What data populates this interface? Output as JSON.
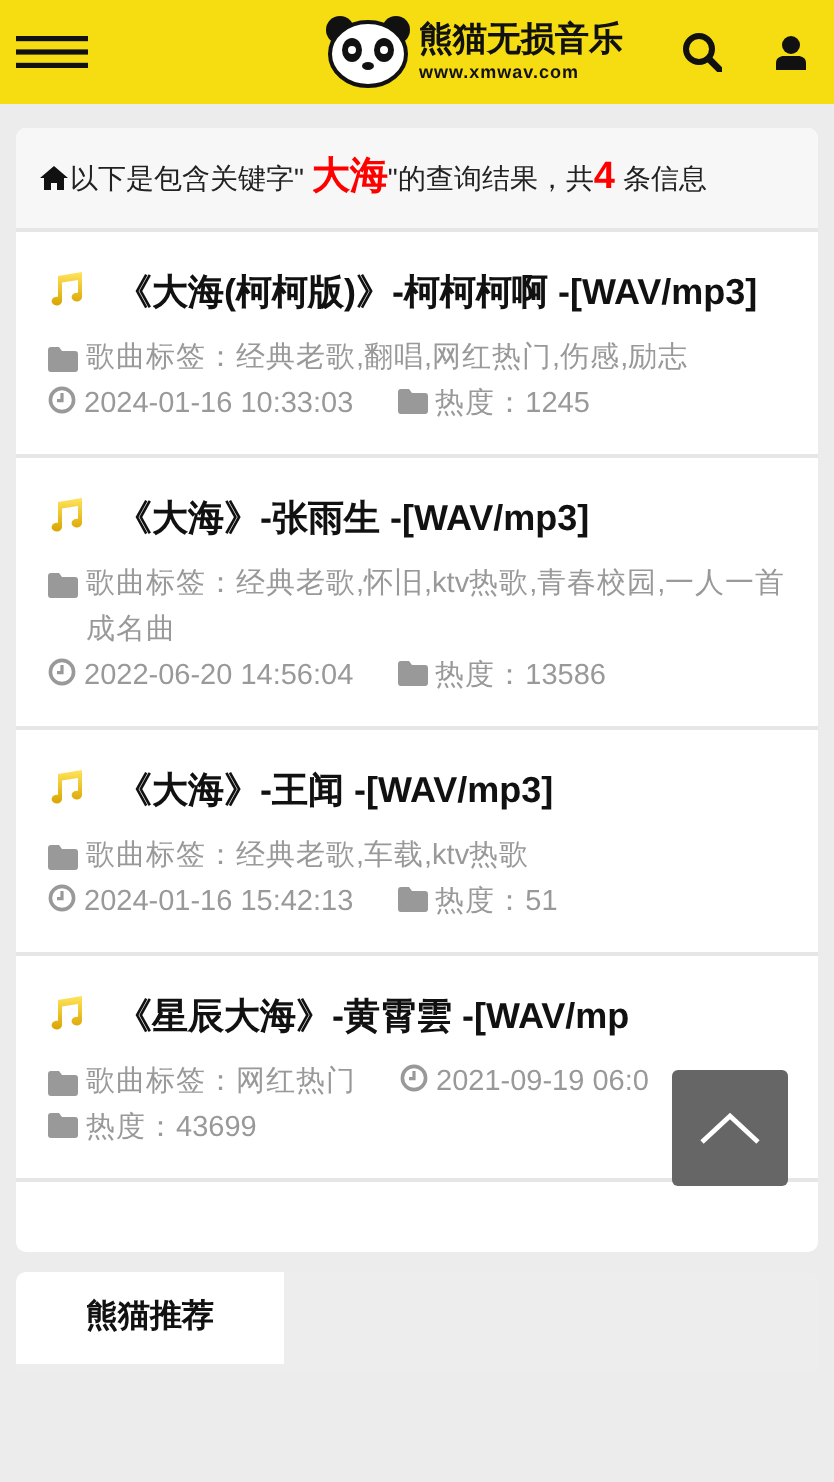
{
  "header": {
    "logo": {
      "title": "熊猫无损音乐",
      "url": "www.xmwav.com"
    }
  },
  "summary": {
    "prefix": "以下是包含关键字\"",
    "keyword": "大海",
    "middle": "\"的查询结果，共",
    "count": "4",
    "suffix": "条信息"
  },
  "results": [
    {
      "title": "《大海(柯柯版)》-柯柯柯啊 -[WAV/mp3]",
      "tags": "歌曲标签：经典老歌,翻唱,网红热门,伤感,励志",
      "date": "2024-01-16 10:33:03",
      "heat": "热度：1245"
    },
    {
      "title": "《大海》-张雨生 -[WAV/mp3]",
      "tags": "歌曲标签：经典老歌,怀旧,ktv热歌,青春校园,一人一首成名曲",
      "date": "2022-06-20 14:56:04",
      "heat": "热度：13586"
    },
    {
      "title": "《大海》-王闻 -[WAV/mp3]",
      "tags": "歌曲标签：经典老歌,车载,ktv热歌",
      "date": "2024-01-16 15:42:13",
      "heat": "热度：51"
    },
    {
      "title": "《星辰大海》-黄霄雲 -[WAV/mp",
      "tags": "歌曲标签：网红热门",
      "date": "2021-09-19 06:0",
      "heat": "热度：43699"
    }
  ],
  "bottom_tabs": [
    {
      "label": "熊猫推荐",
      "selected": true
    }
  ]
}
